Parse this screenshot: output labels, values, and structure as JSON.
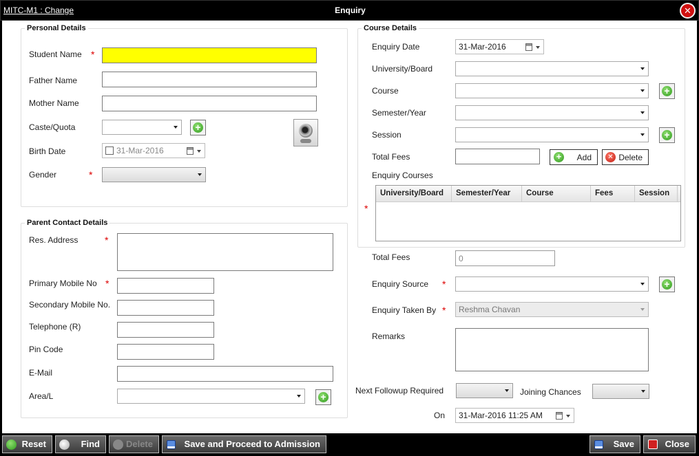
{
  "window": {
    "code_link": "MITC-M1 : Change",
    "title": "Enquiry",
    "close_glyph": "✕"
  },
  "personal": {
    "legend": "Personal Details",
    "student_name_label": "Student Name",
    "student_name_value": "",
    "father_name_label": "Father Name",
    "mother_name_label": "Mother Name",
    "caste_label": "Caste/Quota",
    "birth_date_label": "Birth Date",
    "birth_date_value": "31-Mar-2016",
    "gender_label": "Gender",
    "required_mark": "*"
  },
  "parent": {
    "legend": "Parent Contact Details",
    "address_label": "Res. Address",
    "primary_mobile_label": "Primary Mobile No",
    "secondary_mobile_label": "Secondary Mobile No.",
    "telephone_label": "Telephone (R)",
    "pin_label": "Pin Code",
    "email_label": "E-Mail",
    "area_label": "Area/L"
  },
  "course": {
    "legend": "Course Details",
    "enquiry_date_label": "Enquiry Date",
    "enquiry_date_value": "31-Mar-2016",
    "university_label": "University/Board",
    "course_label": "Course",
    "semester_label": "Semester/Year",
    "session_label": "Session",
    "total_fees_label": "Total Fees",
    "add_label": "Add",
    "delete_label": "Delete",
    "enquiry_courses_label": "Enquiry Courses",
    "columns": [
      "University/Board",
      "Semester/Year",
      "Course",
      "Fees",
      "Session"
    ]
  },
  "right": {
    "total_fees_label": "Total Fees",
    "total_fees_value": "0",
    "source_label": "Enquiry Source",
    "taken_by_label": "Enquiry Taken By",
    "taken_by_value": "Reshma Chavan",
    "remarks_label": "Remarks",
    "followup_label": "Next Followup Required",
    "joining_label": "Joining Chances",
    "on_label": "On",
    "on_value": "31-Mar-2016 11:25 AM"
  },
  "toolbar": {
    "reset": "Reset",
    "find": "Find",
    "delete": "Delete",
    "save_proceed": "Save and Proceed to Admission",
    "save": "Save",
    "close": "Close"
  },
  "colors": {
    "required": "#dd0000",
    "highlight_input": "#ffff00",
    "toolbar_bg": "#000000"
  }
}
